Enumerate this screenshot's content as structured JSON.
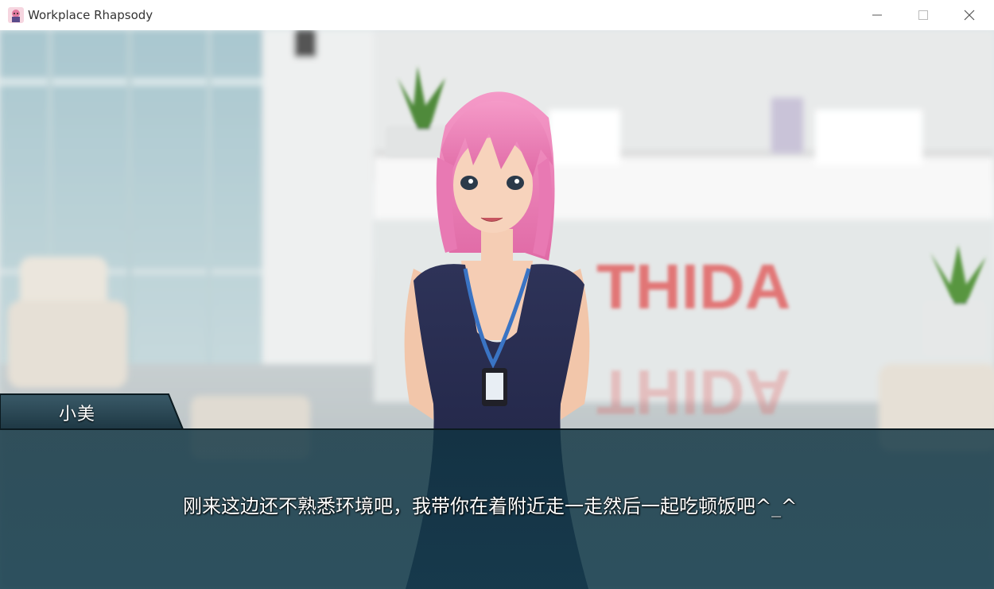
{
  "window": {
    "title": "Workplace Rhapsody",
    "app_icon": "app-icon",
    "controls": [
      "minimize-icon",
      "maximize-icon",
      "close-icon"
    ]
  },
  "scene": {
    "background": "office lobby",
    "sign_text": "THIDA",
    "character": "pink-haired woman with ID badge"
  },
  "dialogue": {
    "speaker": "小美",
    "text": "刚来这边还不熟悉环境吧，我带你在着附近走一走然后一起吃顿饭吧^_^"
  },
  "colors": {
    "dialog_bg": "#103442",
    "name_tab_bg": "#2a4855",
    "sign_red": "#e04848"
  }
}
